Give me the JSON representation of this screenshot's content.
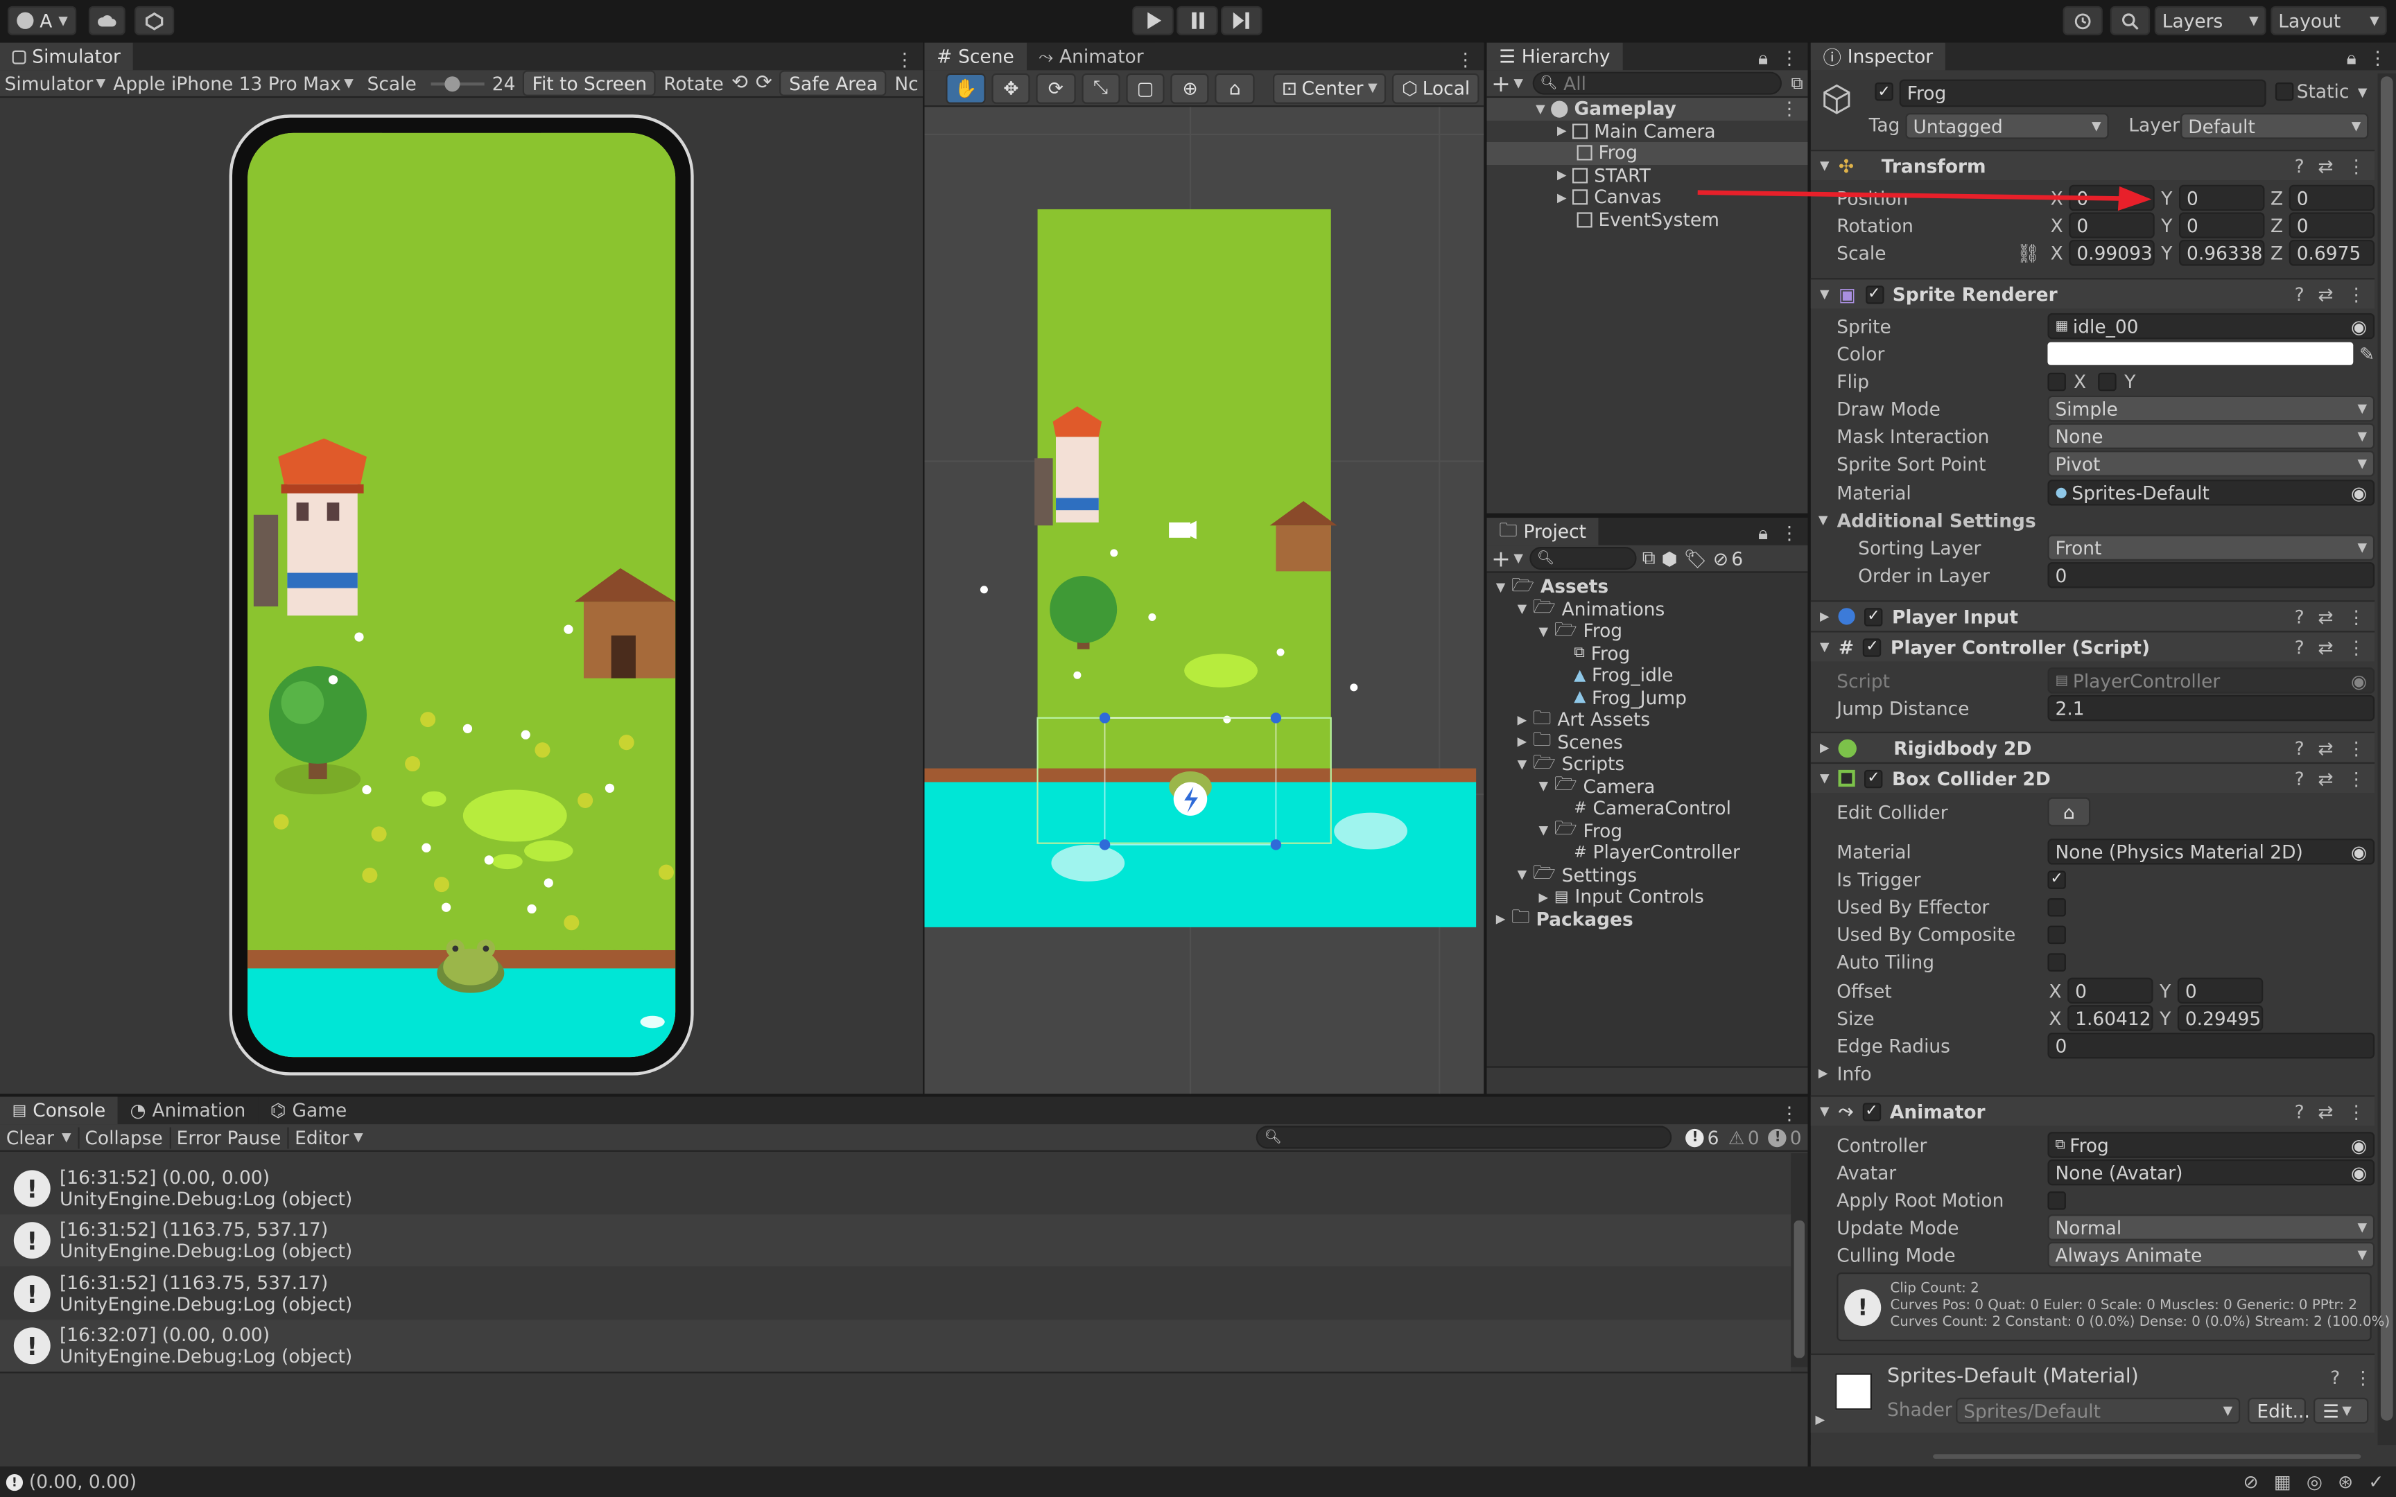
{
  "toolbar": {
    "account_label": "A",
    "layers_label": "Layers",
    "layout_label": "Layout"
  },
  "simulator": {
    "tab_label": "Simulator",
    "mode": "Simulator",
    "device": "Apple iPhone 13 Pro Max",
    "scale_label": "Scale",
    "scale_value": "24",
    "fit_label": "Fit to Screen",
    "rotate_label": "Rotate",
    "safe_area_label": "Safe Area",
    "nc_label": "Nc"
  },
  "scene": {
    "tab_label": "Scene",
    "animator_tab_label": "Animator",
    "pivot_label": "Center",
    "space_label": "Local"
  },
  "hierarchy": {
    "tab_label": "Hierarchy",
    "search_placeholder": "All",
    "items": [
      {
        "label": "Gameplay"
      },
      {
        "label": "Main Camera"
      },
      {
        "label": "Frog"
      },
      {
        "label": "START"
      },
      {
        "label": "Canvas"
      },
      {
        "label": "EventSystem"
      }
    ]
  },
  "project": {
    "tab_label": "Project",
    "hidden_count": "6",
    "items": [
      {
        "label": "Assets"
      },
      {
        "label": "Animations"
      },
      {
        "label": "Frog"
      },
      {
        "label": "Frog"
      },
      {
        "label": "Frog_idle"
      },
      {
        "label": "Frog_Jump"
      },
      {
        "label": "Art Assets"
      },
      {
        "label": "Scenes"
      },
      {
        "label": "Scripts"
      },
      {
        "label": "Camera"
      },
      {
        "label": "CameraControl"
      },
      {
        "label": "Frog"
      },
      {
        "label": "PlayerController"
      },
      {
        "label": "Settings"
      },
      {
        "label": "Input Controls"
      },
      {
        "label": "Packages"
      }
    ]
  },
  "inspector": {
    "tab_label": "Inspector",
    "object_name": "Frog",
    "static_label": "Static",
    "tag_label": "Tag",
    "tag_value": "Untagged",
    "layer_label": "Layer",
    "layer_value": "Default",
    "transform": {
      "title": "Transform",
      "position_label": "Position",
      "rotation_label": "Rotation",
      "scale_label": "Scale",
      "position": {
        "x": "0",
        "y": "0",
        "z": "0"
      },
      "rotation": {
        "x": "0",
        "y": "0",
        "z": "0"
      },
      "scale": {
        "x": "0.990938",
        "y": "0.963387",
        "z": "0.6975"
      }
    },
    "sprite_renderer": {
      "title": "Sprite Renderer",
      "sprite_label": "Sprite",
      "sprite_value": "idle_00",
      "color_label": "Color",
      "flip_label": "Flip",
      "draw_mode_label": "Draw Mode",
      "draw_mode_value": "Simple",
      "mask_label": "Mask Interaction",
      "mask_value": "None",
      "sort_point_label": "Sprite Sort Point",
      "sort_point_value": "Pivot",
      "material_label": "Material",
      "material_value": "Sprites-Default",
      "additional_label": "Additional Settings",
      "sorting_layer_label": "Sorting Layer",
      "sorting_layer_value": "Front",
      "order_label": "Order in Layer",
      "order_value": "0"
    },
    "player_input": {
      "title": "Player Input"
    },
    "player_controller": {
      "title": "Player Controller (Script)",
      "script_label": "Script",
      "script_value": "PlayerController",
      "jump_label": "Jump Distance",
      "jump_value": "2.1"
    },
    "rigidbody": {
      "title": "Rigidbody 2D"
    },
    "box_collider": {
      "title": "Box Collider 2D",
      "edit_label": "Edit Collider",
      "material_label": "Material",
      "material_value": "None (Physics Material 2D)",
      "trigger_label": "Is Trigger",
      "effector_label": "Used By Effector",
      "composite_label": "Used By Composite",
      "tiling_label": "Auto Tiling",
      "offset_label": "Offset",
      "offset_x": "0",
      "offset_y": "0",
      "size_label": "Size",
      "size_x": "1.604122",
      "size_y": "0.294955",
      "radius_label": "Edge Radius",
      "radius_value": "0",
      "info_label": "Info"
    },
    "animator": {
      "title": "Animator",
      "controller_label": "Controller",
      "controller_value": "Frog",
      "avatar_label": "Avatar",
      "avatar_value": "None (Avatar)",
      "root_motion_label": "Apply Root Motion",
      "update_label": "Update Mode",
      "update_value": "Normal",
      "culling_label": "Culling Mode",
      "culling_value": "Always Animate",
      "info_line1": "Clip Count: 2",
      "info_line2": "Curves Pos: 0 Quat: 0 Euler: 0 Scale: 0 Muscles: 0 Generic: 0 PPtr: 2",
      "info_line3": "Curves Count: 2 Constant: 0 (0.0%) Dense: 0 (0.0%) Stream: 2 (100.0%)"
    },
    "material": {
      "title": "Sprites-Default (Material)",
      "shader_label": "Shader",
      "shader_value": "Sprites/Default",
      "edit_label": "Edit..."
    }
  },
  "console": {
    "tab_label": "Console",
    "animation_tab_label": "Animation",
    "game_tab_label": "Game",
    "clear_label": "Clear",
    "collapse_label": "Collapse",
    "error_pause_label": "Error Pause",
    "editor_label": "Editor",
    "log_count": "6",
    "warn_count": "0",
    "error_count": "0",
    "entries": [
      {
        "line1": "[16:31:52] (0.00, 0.00)",
        "line2": "UnityEngine.Debug:Log (object)"
      },
      {
        "line1": "[16:31:52] (1163.75, 537.17)",
        "line2": "UnityEngine.Debug:Log (object)"
      },
      {
        "line1": "[16:31:52] (1163.75, 537.17)",
        "line2": "UnityEngine.Debug:Log (object)"
      },
      {
        "line1": "[16:32:07] (0.00, 0.00)",
        "line2": "UnityEngine.Debug:Log (object)"
      }
    ]
  },
  "status": {
    "message": "(0.00, 0.00)"
  },
  "colors": {
    "accent": "#2c5d87",
    "grass": "#8bc42f",
    "water": "#00e6d6",
    "arrow": "#e8202a"
  }
}
